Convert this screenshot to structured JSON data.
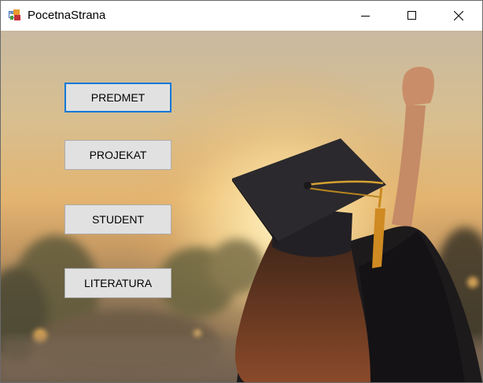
{
  "window": {
    "title": "PocetnaStrana",
    "icon": "windows-form-icon",
    "controls": {
      "minimize_icon": "minimize-icon",
      "maximize_icon": "maximize-icon",
      "close_icon": "close-icon"
    }
  },
  "buttons": {
    "predmet": "PREDMET",
    "projekat": "PROJEKAT",
    "student": "STUDENT",
    "literatura": "LITERATURA"
  },
  "background": {
    "description_icon": "graduation-photo",
    "accent_focus_color": "#0078d7",
    "button_face_color": "#e1e1e1"
  }
}
